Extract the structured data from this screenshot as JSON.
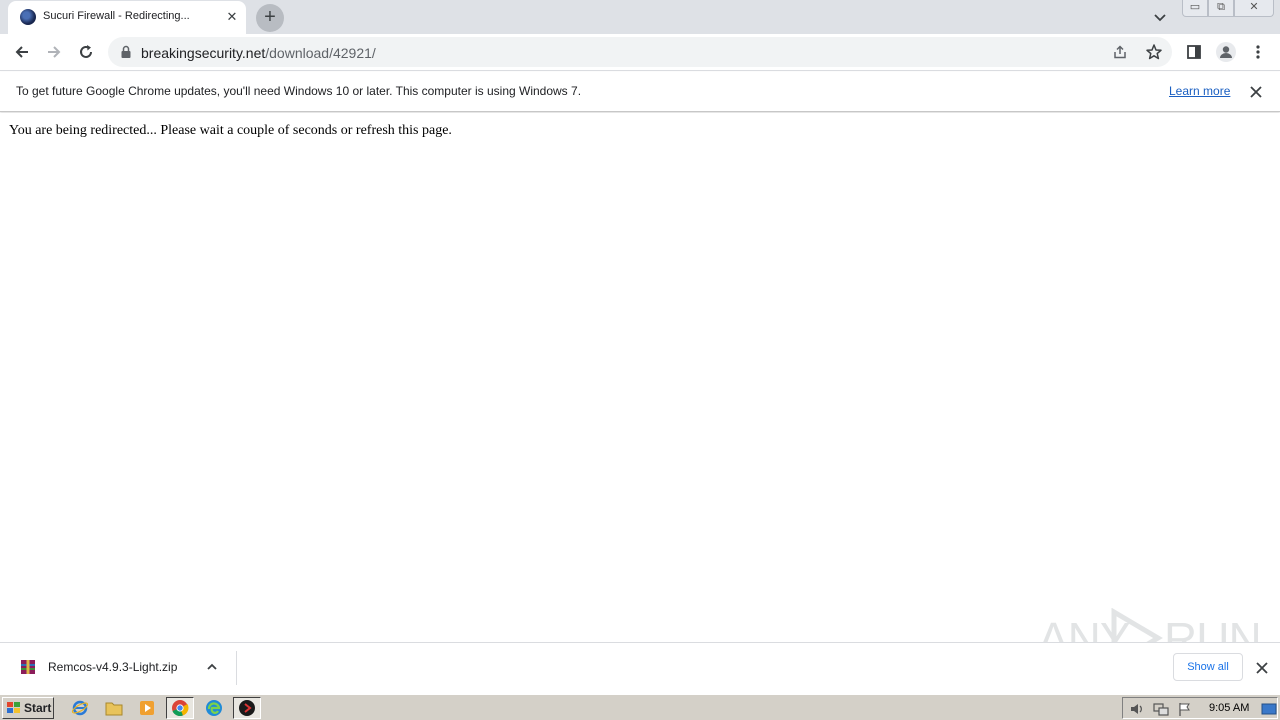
{
  "tab": {
    "title": "Sucuri Firewall - Redirecting...",
    "close_glyph": "✕"
  },
  "newtab_glyph": "+",
  "window_controls": {
    "minimize": "▭",
    "restore": "⧉",
    "close": "✕"
  },
  "address": {
    "domain": "breakingsecurity.net",
    "path": "/download/42921/"
  },
  "infobar": {
    "message": "To get future Google Chrome updates, you'll need Windows 10 or later. This computer is using Windows 7.",
    "link": "Learn more"
  },
  "page": {
    "message": "You are being redirected... Please wait a couple of seconds or refresh this page."
  },
  "watermark": {
    "text_left": "ANY",
    "text_right": "RUN"
  },
  "downloads": {
    "filename": "Remcos-v4.9.3-Light.zip",
    "show_all": "Show all"
  },
  "taskbar": {
    "start_label": "Start",
    "clock": "9:05 AM"
  },
  "colors": {
    "tabstrip": "#dee1e6",
    "link": "#1a5fc2",
    "accent": "#1a73e8",
    "taskbar": "#d4d0c8"
  }
}
